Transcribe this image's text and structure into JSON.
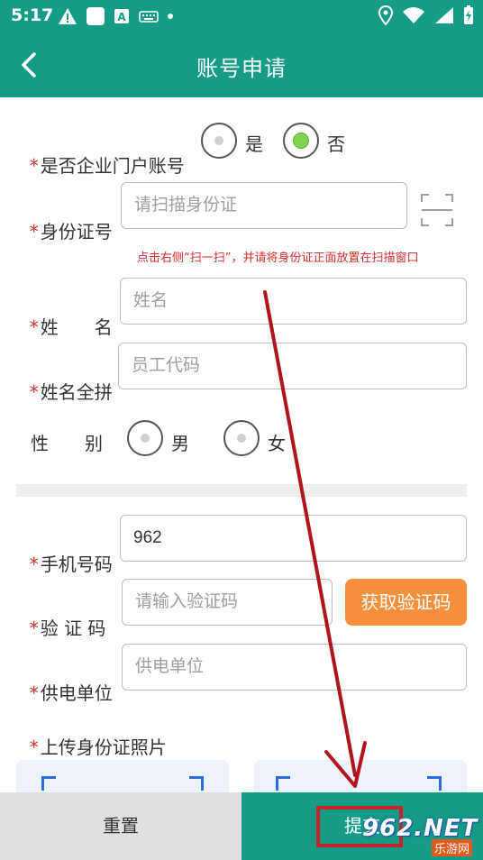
{
  "status_bar": {
    "time": "5:17",
    "left_icons": [
      "alert-icon",
      "app-icon",
      "keyboard-a-icon",
      "keyboard-icon",
      "dot-icon"
    ],
    "right_icons": [
      "location-icon",
      "wifi-icon",
      "signal-icon",
      "battery-icon"
    ]
  },
  "header": {
    "title": "账号申请"
  },
  "form": {
    "enterprise_account": {
      "label": "是否企业门户账号",
      "options": [
        "是",
        "否"
      ],
      "selected": "否"
    },
    "id_number": {
      "label": "身份证号",
      "placeholder": "请扫描身份证",
      "value": ""
    },
    "scan_hint": "点击右侧“扫一扫”，并请将身份证正面放置在扫描窗口",
    "name": {
      "label": "姓　　名",
      "placeholder": "姓名",
      "value": ""
    },
    "name_pinyin": {
      "label": "姓名全拼",
      "placeholder": "员工代码",
      "value": ""
    },
    "gender": {
      "label": "性　　别",
      "options": [
        "男",
        "女"
      ],
      "selected": ""
    },
    "phone": {
      "label": "手机号码",
      "placeholder": "",
      "value": "962"
    },
    "verify_code": {
      "label": "验 证 码",
      "placeholder": "请输入验证码",
      "value": "",
      "get_code_label": "获取验证码"
    },
    "power_unit": {
      "label": "供电单位",
      "placeholder": "供电单位",
      "value": ""
    },
    "upload": {
      "label": "上传身份证照片"
    },
    "required_mark": "*"
  },
  "footer": {
    "reset_label": "重置",
    "submit_label": "提交"
  },
  "watermark": {
    "brand": "962.NET",
    "sub": "乐游网"
  },
  "colors": {
    "primary": "#159b86",
    "accent": "#f7903c",
    "required": "#d32f2f",
    "annotation": "#c8232c",
    "radio_checked": "#7fd34e"
  }
}
